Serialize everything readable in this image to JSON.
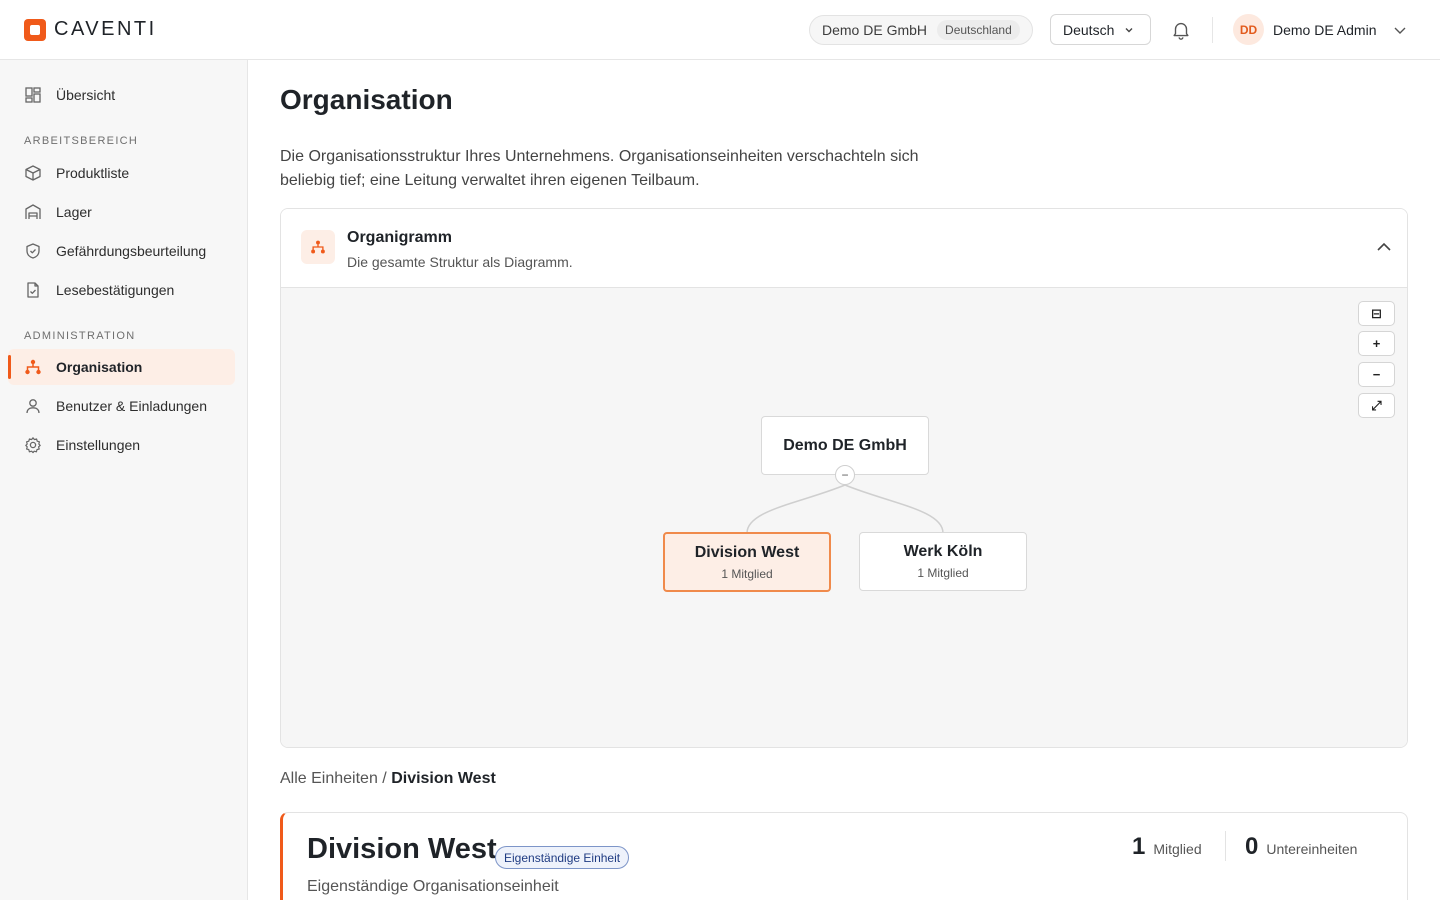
{
  "brand": {
    "name": "CAVENTI",
    "accent": "#f05a1a"
  },
  "header": {
    "tenant_name": "Demo DE GmbH",
    "tenant_country": "Deutschland",
    "language": "Deutsch",
    "user_initials": "DD",
    "user_name": "Demo DE Admin"
  },
  "sidebar": {
    "overview": "Übersicht",
    "section_work": "ARBEITSBEREICH",
    "section_admin": "ADMINISTRATION",
    "items": [
      {
        "label": "Produktliste",
        "icon": "cube-icon"
      },
      {
        "label": "Lager",
        "icon": "warehouse-icon"
      },
      {
        "label": "Gefährdungsbeurteilung",
        "icon": "shield-check-icon"
      },
      {
        "label": "Lesebestätigungen",
        "icon": "document-check-icon"
      },
      {
        "label": "Organisation",
        "icon": "org-chart-icon",
        "active": true
      },
      {
        "label": "Benutzer & Einladungen",
        "icon": "user-icon"
      },
      {
        "label": "Einstellungen",
        "icon": "gear-icon"
      }
    ]
  },
  "main": {
    "title": "Organisation",
    "description": "Die Organisationsstruktur Ihres Unternehmens. Organisationseinheiten verschachteln sich beliebig tief; eine Leitung verwaltet ihren eigenen Teilbaum."
  },
  "orgchart": {
    "title": "Organigramm",
    "subtitle": "Die gesamte Struktur als Diagramm.",
    "zoom_controls": [
      "⊟",
      "+",
      "−",
      "⤢"
    ],
    "root": {
      "name": "Demo DE GmbH",
      "collapse": "−"
    },
    "children": [
      {
        "name": "Division West",
        "members": "1 Mitglied",
        "selected": true
      },
      {
        "name": "Werk Köln",
        "members": "1 Mitglied",
        "selected": false
      }
    ]
  },
  "breadcrumb": {
    "root": "Alle Einheiten",
    "separator": " / ",
    "current": "Division West"
  },
  "detail": {
    "title": "Division West",
    "badge": "Eigenständige Einheit",
    "subtitle": "Eigenständige Organisationseinheit",
    "members_count": "1",
    "members_label": "Mitglied",
    "children_count": "0",
    "children_label": "Untereinheiten"
  }
}
